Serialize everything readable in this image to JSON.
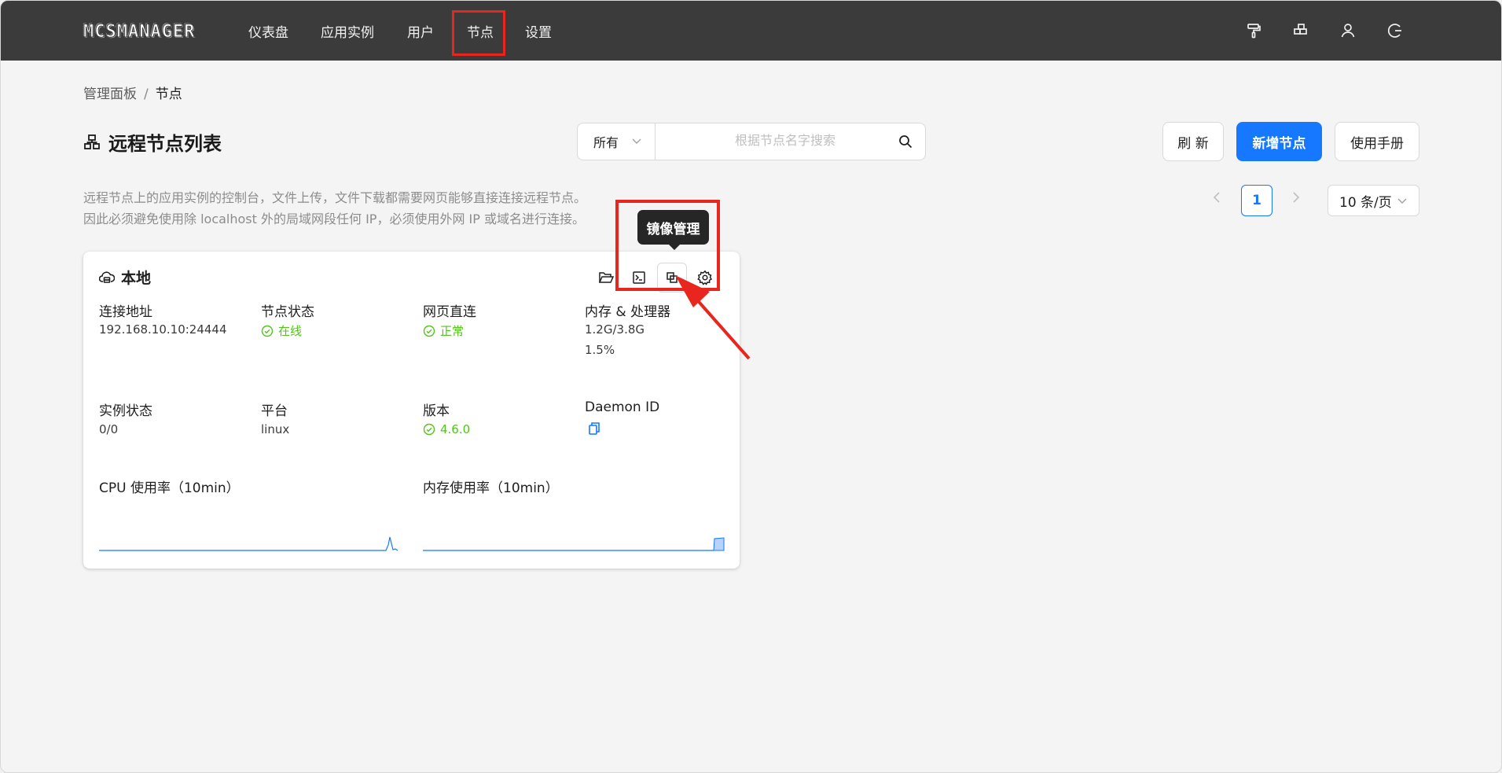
{
  "app": {
    "logo": "MCSMANAGER",
    "nav": [
      "仪表盘",
      "应用实例",
      "用户",
      "节点",
      "设置"
    ],
    "active_nav": "节点"
  },
  "breadcrumb": {
    "root": "管理面板",
    "sep": "/",
    "current": "节点"
  },
  "page": {
    "title": "远程节点列表",
    "filter_value": "所有",
    "search_placeholder": "根据节点名字搜索",
    "buttons": {
      "refresh": "刷 新",
      "add": "新增节点",
      "manual": "使用手册"
    },
    "description": [
      "远程节点上的应用实例的控制台，文件上传，文件下载都需要网页能够直接连接远程节点。",
      "因此必须避免使用除 localhost 外的局域网段任何 IP，必须使用外网 IP 或域名进行连接。"
    ]
  },
  "pagination": {
    "current": "1",
    "page_size": "10 条/页"
  },
  "node_card": {
    "name": "本地",
    "tooltip": "镜像管理",
    "stats": {
      "address_label": "连接地址",
      "address": "192.168.10.10:24444",
      "status_label": "节点状态",
      "status": "在线",
      "direct_label": "网页直连",
      "direct": "正常",
      "mem_cpu_label": "内存 & 处理器",
      "mem": "1.2G/3.8G",
      "cpu": "1.5%",
      "instance_label": "实例状态",
      "instance": "0/0",
      "platform_label": "平台",
      "platform": "linux",
      "version_label": "版本",
      "version": "4.6.0",
      "daemon_label": "Daemon ID"
    },
    "cpu_chart_label": "CPU 使用率（10min）",
    "mem_chart_label": "内存使用率（10min）"
  },
  "colors": {
    "topbar": "#3b3b3b",
    "primary": "#1677ff",
    "success": "#52c41a",
    "highlight": "#e8261d"
  }
}
